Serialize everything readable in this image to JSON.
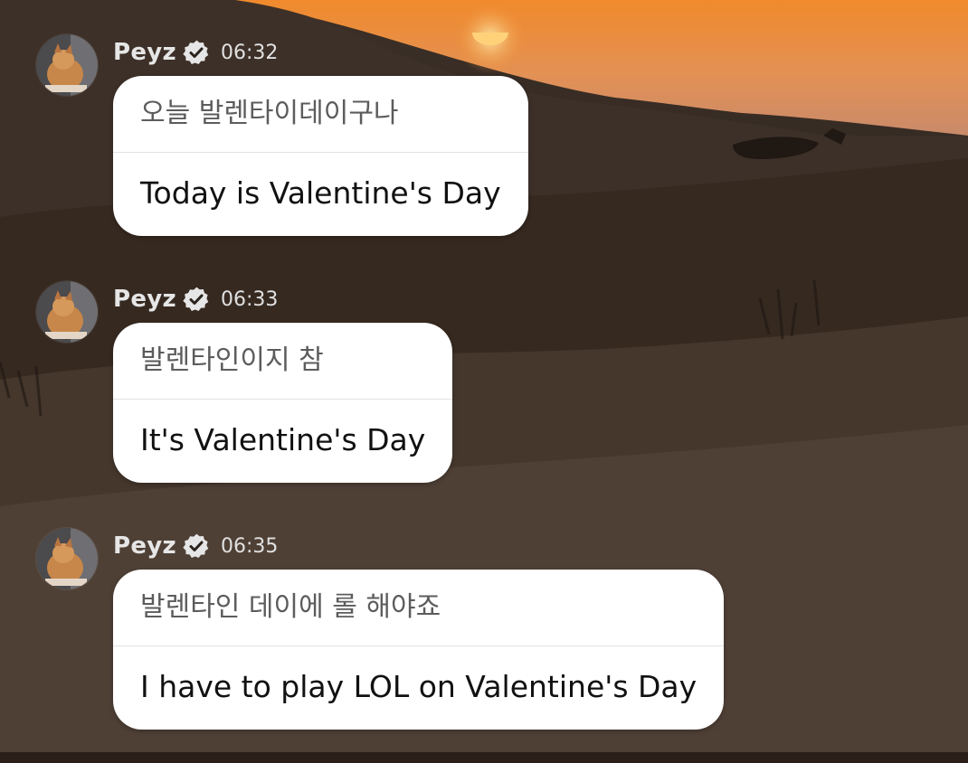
{
  "background": {
    "description_icon": "desert-sunset-wallpaper",
    "sky_color": "#e8853a",
    "sun_color": "#ffd27a",
    "dune_color": "#3a2c22"
  },
  "accent": {
    "bubble_bg": "#ffffff",
    "name_color": "#e6e6e6",
    "verified_color": "#e6e6e6"
  },
  "messages": [
    {
      "sender": "Peyz",
      "verified": true,
      "time": "06:32",
      "original": "오늘 발렌타이데이구나",
      "translation": "Today is Valentine's Day"
    },
    {
      "sender": "Peyz",
      "verified": true,
      "time": "06:33",
      "original": "발렌타인이지 참",
      "translation": "It's Valentine's Day"
    },
    {
      "sender": "Peyz",
      "verified": true,
      "time": "06:35",
      "original": "발렌타인 데이에 롤 해야죠",
      "translation": "I have to play LOL on Valentine's Day"
    }
  ]
}
